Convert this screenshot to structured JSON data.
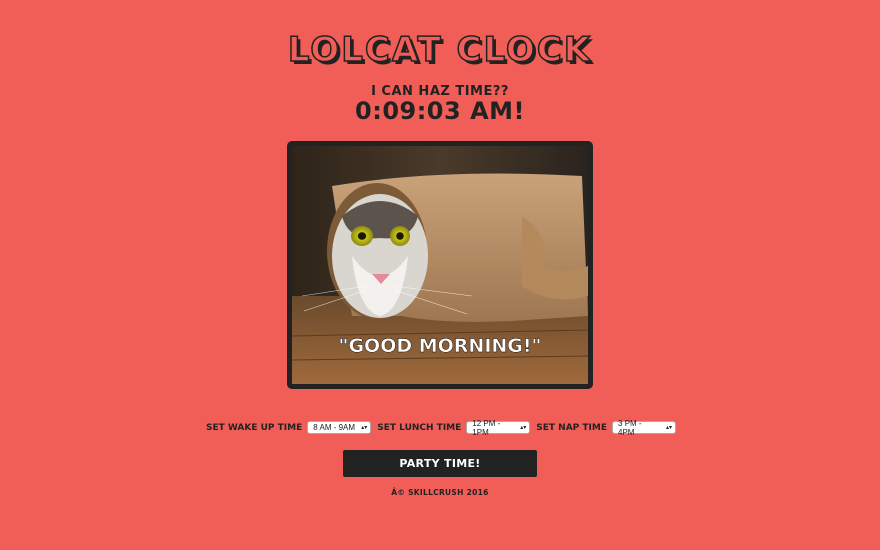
{
  "header": {
    "title": "Lolcat Clock",
    "subtitle": "I can haz time??",
    "clock": "0:09:03 AM!"
  },
  "photo": {
    "caption": "\"GOOD MORNING!\""
  },
  "controls": {
    "wakeup": {
      "label": "Set Wake Up Time",
      "selected": "8 AM - 9AM"
    },
    "lunch": {
      "label": "Set Lunch Time",
      "selected": "12 PM - 1PM"
    },
    "nap": {
      "label": "Set Nap Time",
      "selected": "3 PM - 4PM"
    },
    "party_button": "Party Time!"
  },
  "footer": {
    "text": "Â© Skillcrush 2016"
  },
  "colors": {
    "background": "#f15e58",
    "text": "#222222",
    "button": "#222222"
  },
  "icons": {
    "select_arrow": "updown-chevron-icon"
  }
}
